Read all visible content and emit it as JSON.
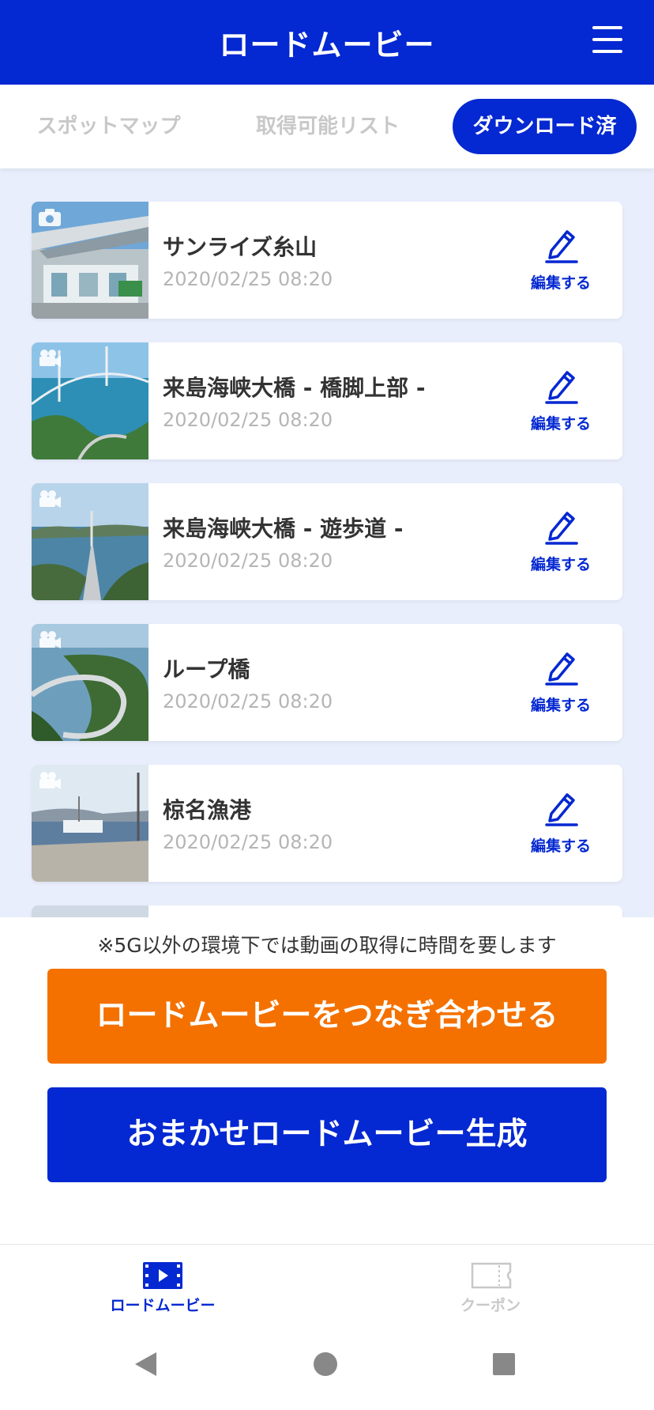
{
  "header": {
    "title": "ロードムービー",
    "menu_icon": "hamburger-menu-icon"
  },
  "tabs": [
    {
      "label": "スポットマップ",
      "active": false
    },
    {
      "label": "取得可能リスト",
      "active": false
    },
    {
      "label": "ダウンロード済",
      "active": true
    }
  ],
  "items": [
    {
      "title": "サンライズ糸山",
      "date": "2020/02/25 08:20",
      "type": "photo",
      "edit_label": "編集する"
    },
    {
      "title": "来島海峡大橋 - 橋脚上部 -",
      "date": "2020/02/25 08:20",
      "type": "video",
      "edit_label": "編集する"
    },
    {
      "title": "来島海峡大橋 - 遊歩道 -",
      "date": "2020/02/25 08:20",
      "type": "video",
      "edit_label": "編集する"
    },
    {
      "title": "ループ橋",
      "date": "2020/02/25 08:20",
      "type": "video",
      "edit_label": "編集する"
    },
    {
      "title": "椋名漁港",
      "date": "2020/02/25 08:20",
      "type": "video",
      "edit_label": "編集する"
    }
  ],
  "notice": "※5G以外の環境下では動画の取得に時間を要します",
  "buttons": {
    "merge": "ロードムービーをつなぎ合わせる",
    "auto": "おまかせロードムービー生成"
  },
  "bottom_nav": [
    {
      "label": "ロードムービー",
      "icon": "film-icon",
      "active": true
    },
    {
      "label": "クーポン",
      "icon": "coupon-ticket-icon",
      "active": false
    }
  ],
  "colors": {
    "primary": "#0428d1",
    "accent": "#f47100",
    "background": "#e9eefc",
    "inactive": "#c8c8c8"
  }
}
